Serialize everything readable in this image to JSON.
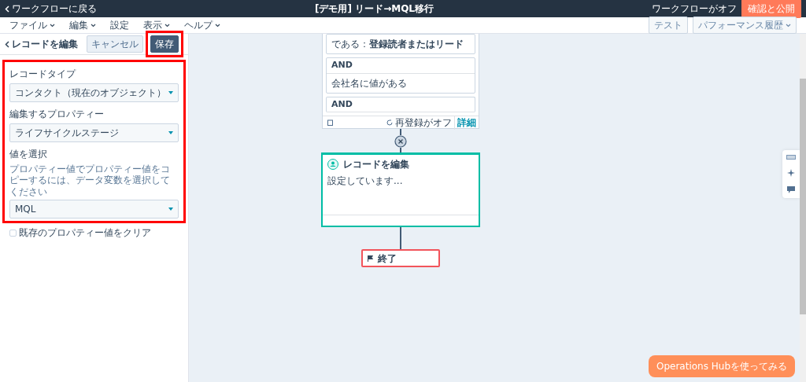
{
  "header": {
    "back_link": "ワークフローに戻る",
    "title": "[デモ用] リード→MQL移行",
    "status": "ワークフローがオフ",
    "publish_button": "確認と公開"
  },
  "menu": {
    "items": [
      {
        "label": "ファイル",
        "dropdown": true
      },
      {
        "label": "編集",
        "dropdown": true
      },
      {
        "label": "設定",
        "dropdown": false
      },
      {
        "label": "表示",
        "dropdown": true
      },
      {
        "label": "ヘルプ",
        "dropdown": true
      }
    ],
    "right_buttons": [
      {
        "label": "テスト",
        "dropdown": false
      },
      {
        "label": "パフォーマンス履歴",
        "dropdown": true
      }
    ]
  },
  "panel": {
    "back_title": "レコードを編集",
    "buttons": [
      {
        "label": "キャンセル",
        "kind": "secondary"
      },
      {
        "label": "保存",
        "kind": "primary"
      }
    ],
    "fields": [
      {
        "label": "レコードタイプ",
        "value": "コンタクト（現在のオブジェクト）"
      },
      {
        "label": "編集するプロパティー",
        "value": "ライフサイクルステージ"
      },
      {
        "label": "値を選択",
        "hint": "プロパティー値でプロパティー値をコピーするには、データ変数を選択してください",
        "value": "MQL"
      }
    ],
    "checkbox": {
      "label": "既存のプロパティー値をクリア",
      "checked": false
    }
  },
  "canvas": {
    "condition_card": {
      "conditions": [
        {
          "text": "である：**登録読者またはリード**"
        },
        {
          "operator": "AND",
          "text": "会社名に値がある"
        },
        {
          "operator": "AND"
        }
      ],
      "reenroll": "再登録がオフ",
      "details_link": "詳細"
    },
    "action_card": {
      "title": "レコードを編集",
      "body": "設定しています..."
    },
    "end_card": {
      "label": "終了"
    }
  },
  "promo_button": "Operations Hubを使ってみる"
}
